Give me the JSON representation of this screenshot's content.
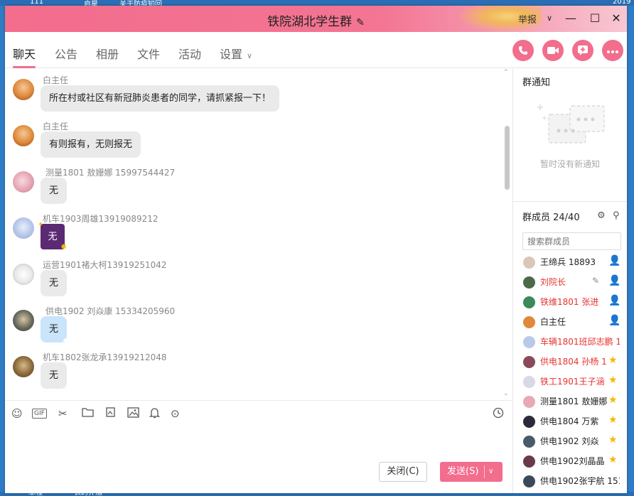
{
  "window": {
    "title": "铁院湖北学生群",
    "title_edit_icon": "edit-icon",
    "title_menu": "举报",
    "colors": {
      "accent": "#f36d8d",
      "red_name": "#e8332f",
      "owner_badge": "#4caf50",
      "admin_badge": "#f5b800"
    }
  },
  "desktop": {
    "top_labels": [
      "111",
      "启星",
      "关于防疫知回",
      "2019"
    ],
    "bottom_labels": [
      "章程",
      "长的养殖"
    ]
  },
  "tabs": [
    {
      "label": "聊天"
    },
    {
      "label": "公告"
    },
    {
      "label": "相册"
    },
    {
      "label": "文件"
    },
    {
      "label": "活动"
    },
    {
      "label": "设置"
    }
  ],
  "actions": [
    {
      "icon": "phone-icon"
    },
    {
      "icon": "video-call-icon"
    },
    {
      "icon": "add-app-icon"
    },
    {
      "icon": "more-icon"
    }
  ],
  "messages": [
    {
      "sender": "白主任",
      "text": "所在村或社区有新冠肺炎患者的同学，请抓紧报一下！",
      "style": "gray"
    },
    {
      "sender": "白主任",
      "text": "有则报有，无则报无",
      "style": "gray"
    },
    {
      "sender": "测量1801 敖姗娜 15997544427",
      "text": "无",
      "style": "gray"
    },
    {
      "sender": "机车1903周雄13919089212",
      "text": "无",
      "style": "purple"
    },
    {
      "sender": "运营1901褚大柯13919251042",
      "text": "无",
      "style": "gray"
    },
    {
      "sender": "供电1902  刘焱康  15334205960",
      "text": "无",
      "style": "blue"
    },
    {
      "sender": "机车1802张龙承13919212048",
      "text": "无",
      "style": "gray"
    }
  ],
  "toolbar": {
    "gif_label": "GIF",
    "icons": [
      "emoji-icon",
      "gif-icon",
      "scissors-icon",
      "folder-icon",
      "image-gallery-icon",
      "image-icon",
      "bell-icon",
      "more-circle-icon",
      "history-clock-icon"
    ]
  },
  "input": {
    "close_label": "关闭(C)",
    "send_label": "发送(S)"
  },
  "notice": {
    "title": "群通知",
    "empty_text": "暂时没有新通知"
  },
  "members": {
    "title": "群成员 24/40",
    "search_placeholder": "搜索群成员",
    "list": [
      {
        "name": "王缔兵  18893",
        "red": false,
        "badge": "owner"
      },
      {
        "name": "刘院长",
        "red": true,
        "badge": "owner",
        "edit": true
      },
      {
        "name": "铁维1801 张进",
        "red": true,
        "badge": "owner"
      },
      {
        "name": "白主任",
        "red": false,
        "badge": "owner"
      },
      {
        "name": "车辆1801班邱志鹏 1",
        "red": true,
        "badge": "none"
      },
      {
        "name": "供电1804 孙杨 1",
        "red": true,
        "badge": "admin"
      },
      {
        "name": "铁工1901王子涵",
        "red": true,
        "badge": "admin"
      },
      {
        "name": "测量1801 敖姗娜",
        "red": false,
        "badge": "admin"
      },
      {
        "name": "供电1804  万紫",
        "red": false,
        "badge": "admin"
      },
      {
        "name": "供电1902  刘焱",
        "red": false,
        "badge": "admin"
      },
      {
        "name": "供电1902刘晶晶",
        "red": false,
        "badge": "admin"
      },
      {
        "name": "供电1902张宇航 151",
        "red": false,
        "badge": "none"
      }
    ]
  }
}
